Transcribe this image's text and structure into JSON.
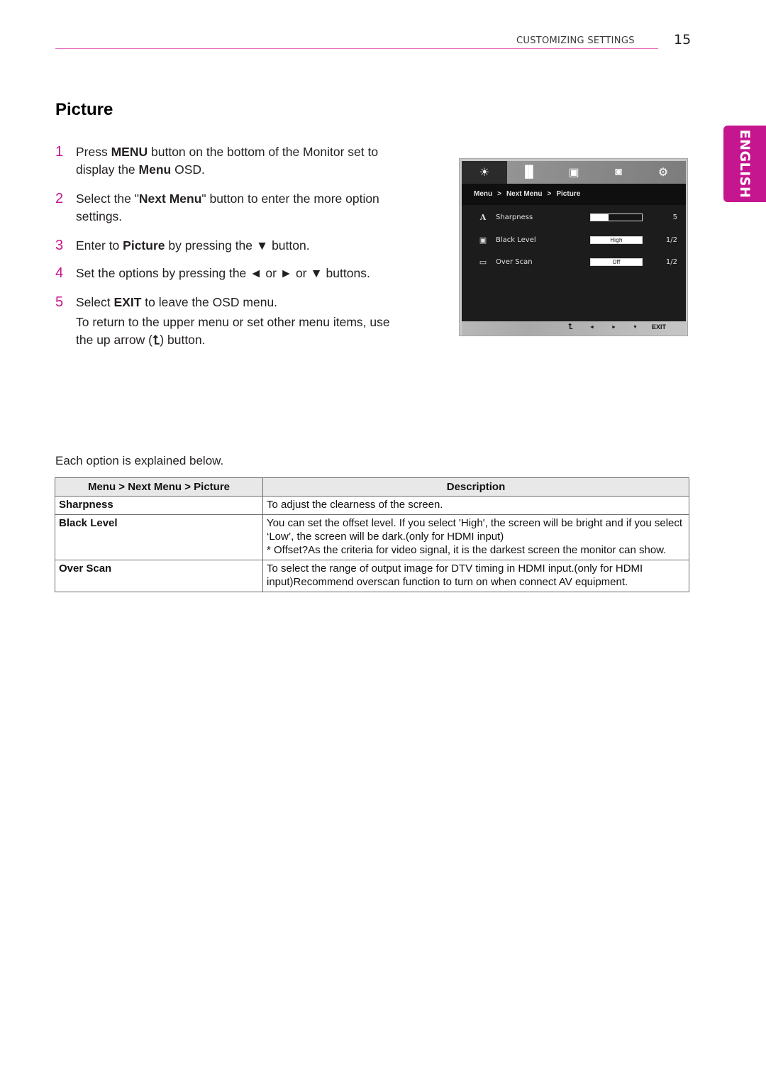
{
  "header": {
    "section": "CUSTOMIZING SETTINGS",
    "page_number": "15",
    "accent_color": "#c5168f"
  },
  "language_tab": "ENGLISH",
  "title": "Picture",
  "steps": [
    {
      "num": "1",
      "parts": [
        "Press ",
        "MENU",
        " button on the bottom of the Monitor set to display the ",
        "Menu",
        " OSD."
      ]
    },
    {
      "num": "2",
      "parts": [
        "Select the \"",
        "Next Menu",
        "\" button to enter the more option settings."
      ]
    },
    {
      "num": "3",
      "parts": [
        "Enter to ",
        "Picture",
        " by pressing the ▼ button."
      ]
    },
    {
      "num": "4",
      "parts": [
        "Set the options by pressing the ◄ or ► or ▼ buttons."
      ]
    },
    {
      "num": "5",
      "parts": [
        "Select ",
        "EXIT",
        " to leave the OSD menu."
      ],
      "sub_before": "To return to the upper menu or set other menu items, use the up arrow (",
      "sub_icon": "up-arrow-icon",
      "sub_after": ") button."
    }
  ],
  "osd": {
    "tabs": [
      {
        "icon": "brightness-icon",
        "glyph": "☀",
        "active": true
      },
      {
        "icon": "color-bars-icon",
        "glyph": "▐▌",
        "active": false
      },
      {
        "icon": "picture-in-picture-icon",
        "glyph": "▣",
        "active": false
      },
      {
        "icon": "disc-icon",
        "glyph": "◙",
        "active": false
      },
      {
        "icon": "settings-gear-icon",
        "glyph": "⚙",
        "active": false
      }
    ],
    "breadcrumb": [
      "Menu",
      "Next Menu",
      "Picture"
    ],
    "breadcrumb_sep": ">",
    "rows": [
      {
        "icon": "sharpness-icon",
        "glyph": "A",
        "label": "Sharpness",
        "type": "slider",
        "level_fraction": 0.35,
        "value": "5"
      },
      {
        "icon": "black-level-icon",
        "glyph": "▣",
        "label": "Black Level",
        "type": "option",
        "option": "High",
        "value": "1/2"
      },
      {
        "icon": "over-scan-icon",
        "glyph": "▭",
        "label": "Over Scan",
        "type": "option",
        "option": "Off",
        "value": "1/2"
      }
    ],
    "footer": {
      "up": "⮤",
      "left": "◄",
      "right": "►",
      "down": "▼",
      "exit": "EXIT"
    }
  },
  "explain_text": "Each option is explained below.",
  "table": {
    "headers": [
      "Menu > Next Menu > Picture",
      "Description"
    ],
    "rows": [
      {
        "name": "Sharpness",
        "desc": [
          "To adjust the clearness of the screen."
        ]
      },
      {
        "name": "Black Level",
        "desc": [
          "You can set the offset level. If you select 'High', the screen will be bright and if you select ‘Low’, the screen will be dark.(only for HDMI input)",
          "* Offset?As the criteria for video signal, it is the darkest screen the monitor can show."
        ]
      },
      {
        "name": "Over Scan",
        "desc": [
          "To select the range of output image for DTV timing in HDMI input.(only for HDMI input)Recommend overscan function to turn on when connect AV equipment."
        ]
      }
    ]
  }
}
